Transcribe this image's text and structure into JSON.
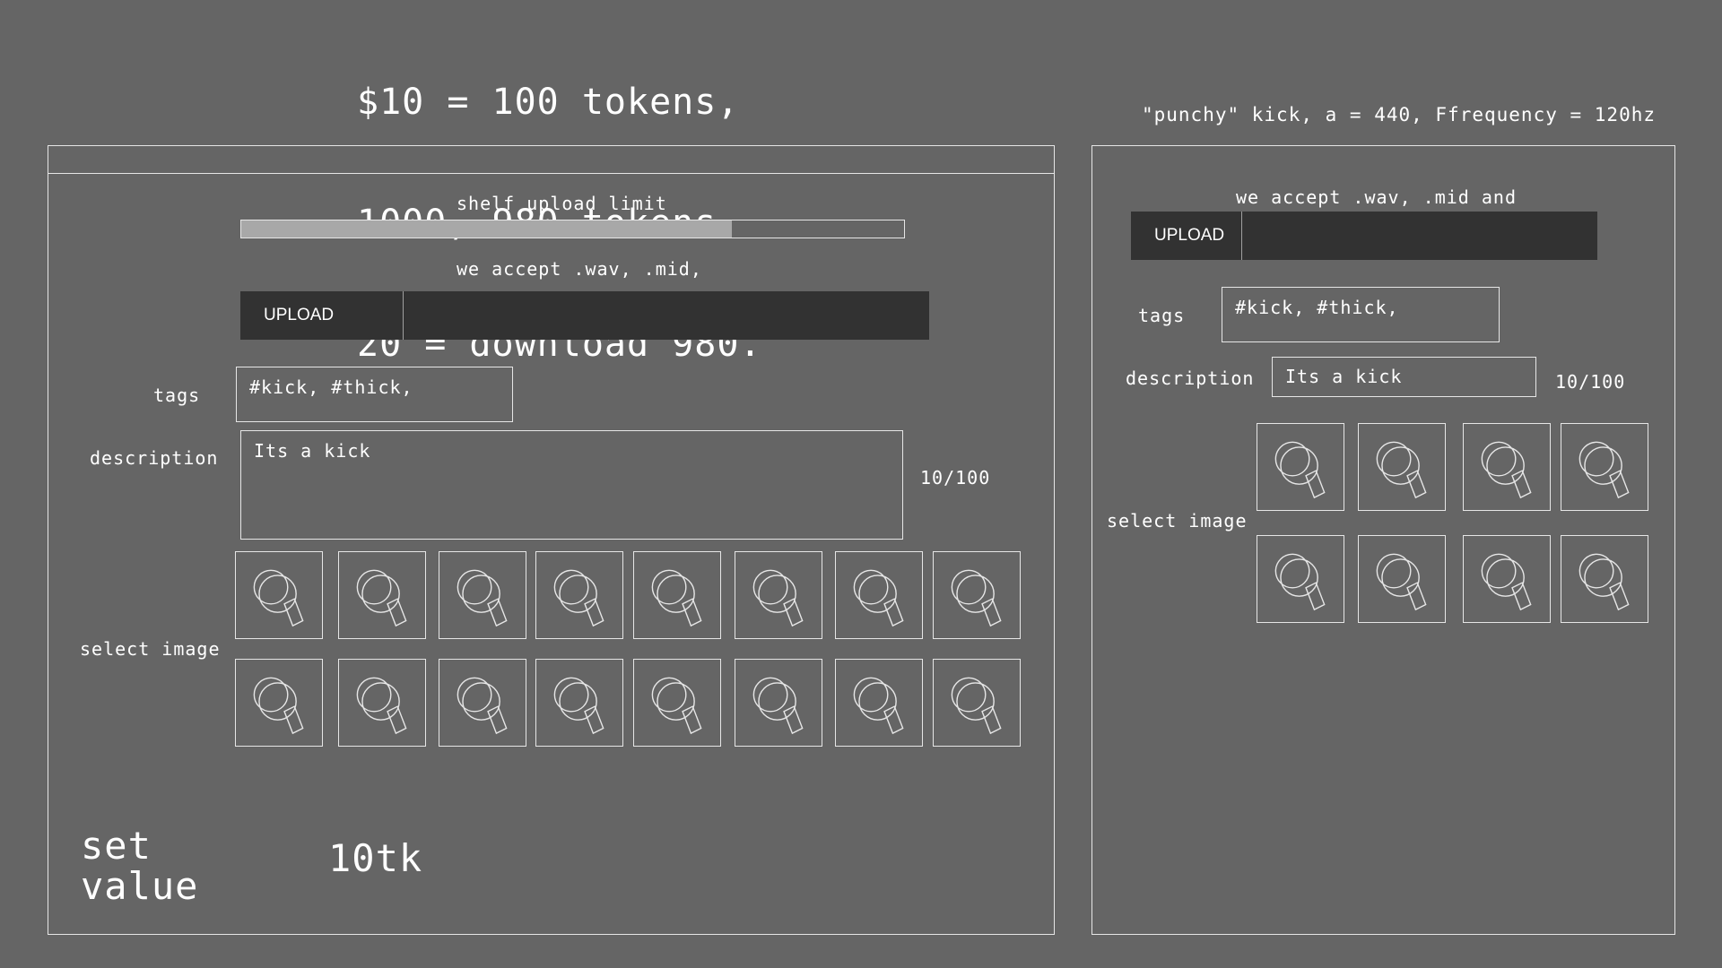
{
  "header": {
    "note_lines": [
      "$10 = 100 tokens,",
      "1000, 980 tokens.",
      "20 = download 980."
    ],
    "right_note": "\"punchy\" kick, a = 440, Ffrequency = 120hz"
  },
  "left_panel": {
    "shelf_label": "shelf upload limit",
    "shelf_progress_percent": 74,
    "accept_text": "we accept .wav, .mid,",
    "upload_label": "UPLOAD",
    "tags_label": "tags",
    "tags_value": "#kick, #thick,",
    "description_label": "description",
    "description_value": "Its a kick",
    "char_count": "10/100",
    "select_image_label": "select image",
    "set_value_line1": "set",
    "set_value_line2": "value",
    "value": "10tk",
    "thumb_icon": "magnifier-icon"
  },
  "right_panel": {
    "accept_text": "we accept .wav, .mid and",
    "upload_label": "UPLOAD",
    "tags_label": "tags",
    "tags_value": "#kick, #thick,",
    "description_label": "description",
    "description_value": "Its a kick",
    "char_count": "10/100",
    "select_image_label": "select image",
    "thumb_icon": "magnifier-icon"
  },
  "colors": {
    "background": "#656565",
    "upload_bar": "#323232",
    "progress_fill": "#a8a8a8",
    "stroke": "#e6e6e6"
  }
}
